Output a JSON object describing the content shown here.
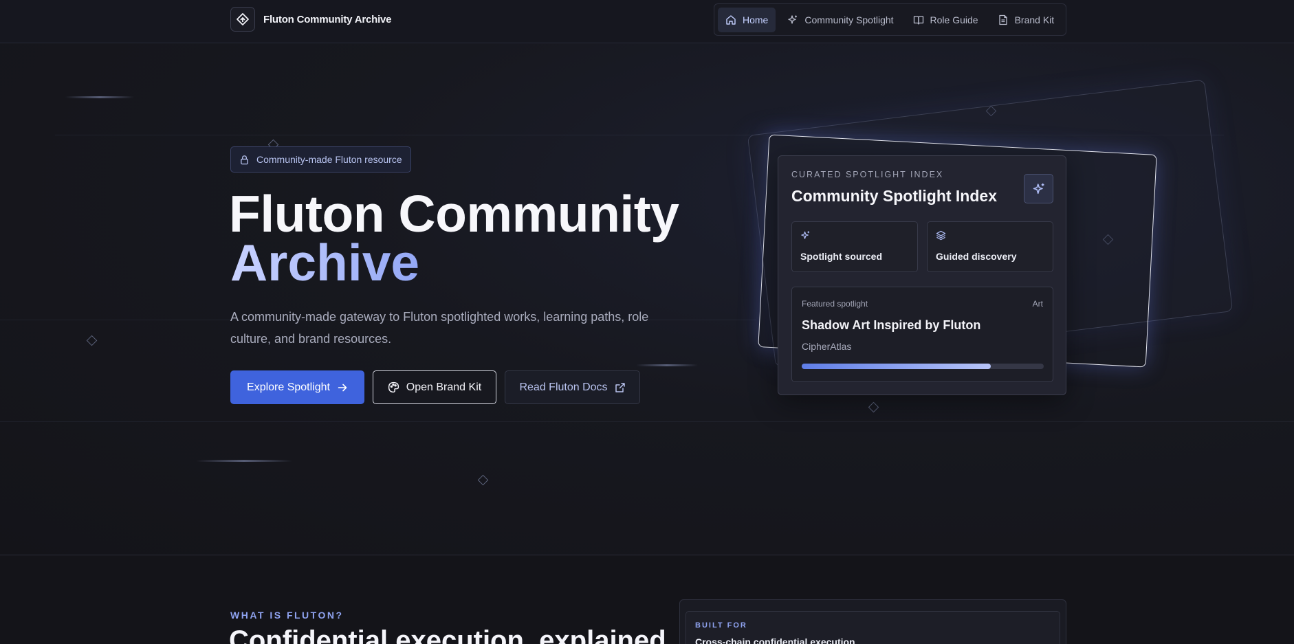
{
  "header": {
    "brand_name": "Fluton Community Archive",
    "nav": [
      {
        "label": "Home",
        "icon": "home-icon",
        "active": true
      },
      {
        "label": "Community Spotlight",
        "icon": "sparkles-icon",
        "active": false
      },
      {
        "label": "Role Guide",
        "icon": "book-open-icon",
        "active": false
      },
      {
        "label": "Brand Kit",
        "icon": "file-text-icon",
        "active": false
      }
    ]
  },
  "hero": {
    "badge": "Community-made Fluton resource",
    "title_line1": "Fluton Community",
    "title_line2": "Archive",
    "description": "A community-made gateway to Fluton spotlighted works, learning paths, role culture, and brand resources.",
    "buttons": {
      "explore": "Explore Spotlight",
      "brand_kit": "Open Brand Kit",
      "docs": "Read Fluton Docs"
    }
  },
  "spotlight_card": {
    "kicker": "CURATED SPOTLIGHT INDEX",
    "title": "Community Spotlight Index",
    "features": [
      {
        "label": "Spotlight sourced",
        "icon": "sparkles-icon"
      },
      {
        "label": "Guided discovery",
        "icon": "layers-icon"
      }
    ],
    "featured": {
      "kicker": "Featured spotlight",
      "tag": "Art",
      "title": "Shadow Art Inspired by Fluton",
      "author": "CipherAtlas",
      "progress": 0.78
    }
  },
  "about": {
    "kicker": "WHAT IS FLUTON?",
    "title": "Confidential execution, explained",
    "built_for_kicker": "BUILT FOR",
    "built_for_text": "Cross-chain confidential execution"
  },
  "colors": {
    "accent": "#3f63dd",
    "accent_soft": "#94a8f6",
    "background": "#15161e"
  }
}
